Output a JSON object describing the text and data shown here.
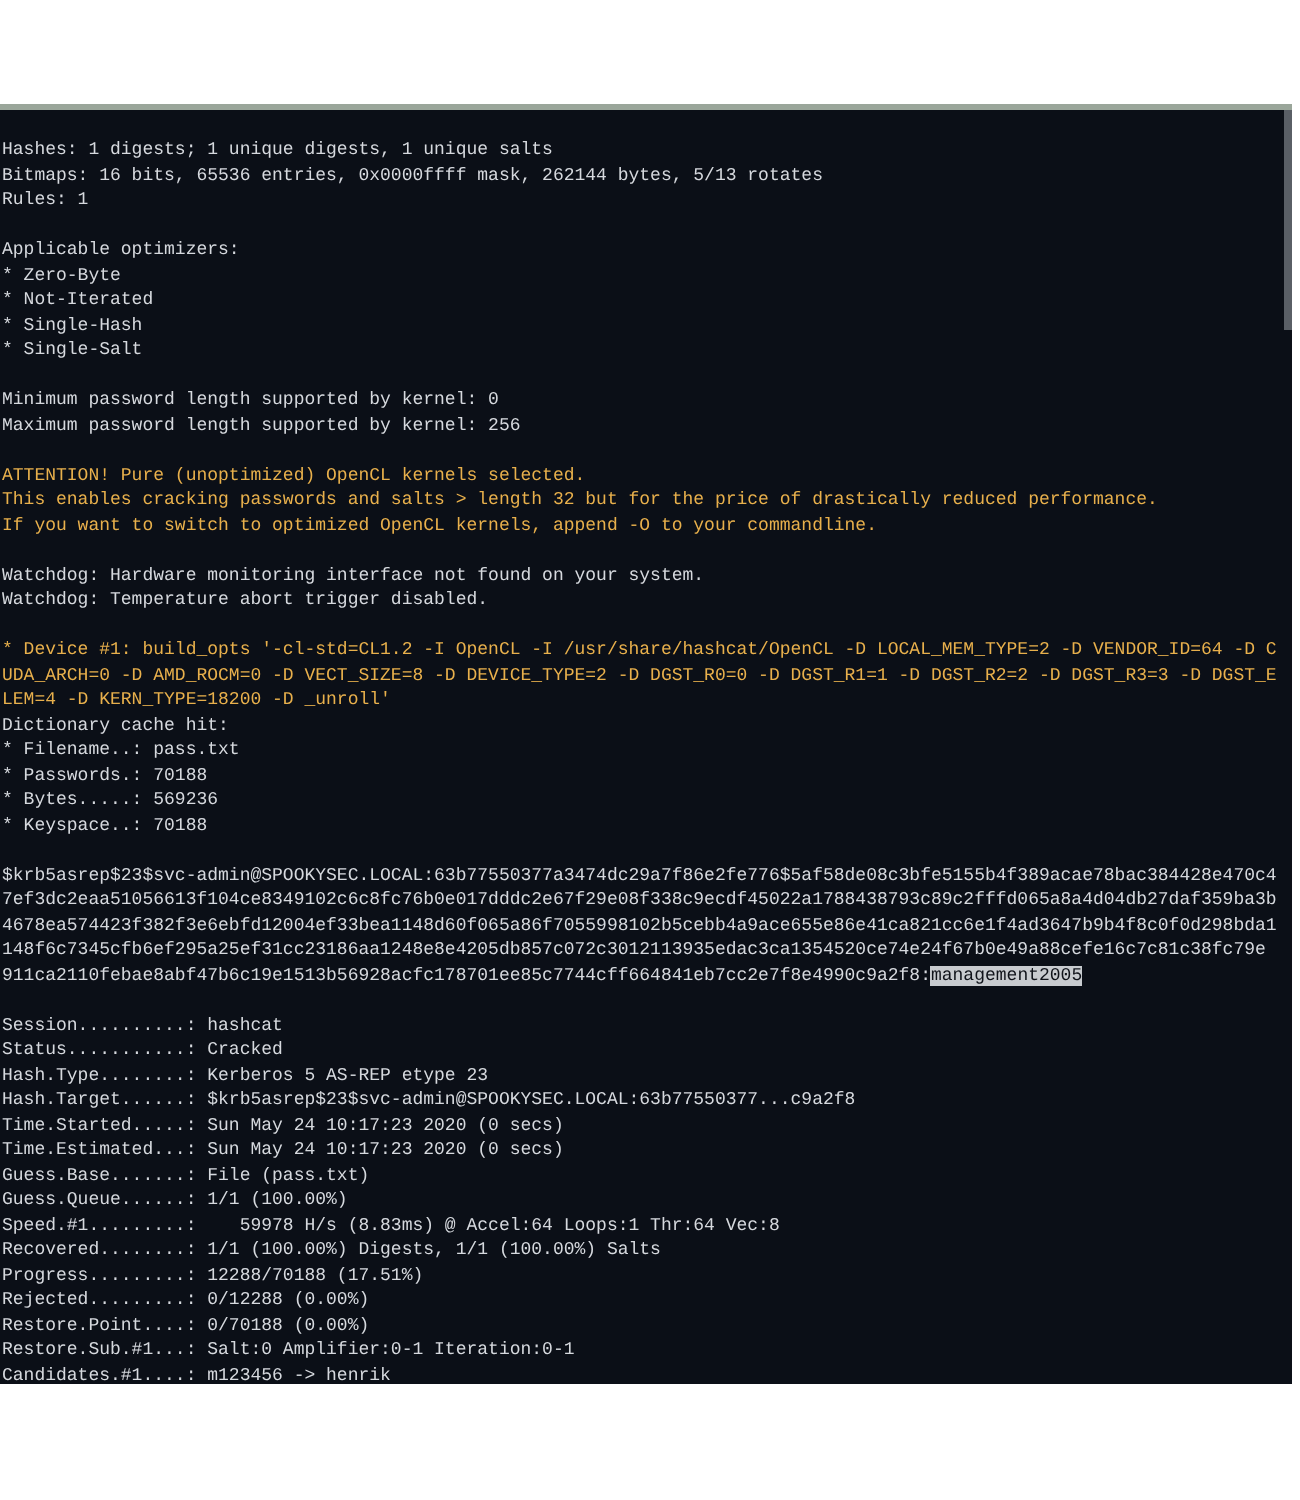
{
  "terminal": {
    "blocks": [
      {
        "lines": [
          {
            "kind": "plain",
            "text": "Hashes: 1 digests; 1 unique digests, 1 unique salts"
          },
          {
            "kind": "plain",
            "text": "Bitmaps: 16 bits, 65536 entries, 0x0000ffff mask, 262144 bytes, 5/13 rotates"
          },
          {
            "kind": "plain",
            "text": "Rules: 1"
          }
        ]
      },
      {
        "lines": [
          {
            "kind": "plain",
            "text": "Applicable optimizers:"
          },
          {
            "kind": "plain",
            "text": "* Zero-Byte"
          },
          {
            "kind": "plain",
            "text": "* Not-Iterated"
          },
          {
            "kind": "plain",
            "text": "* Single-Hash"
          },
          {
            "kind": "plain",
            "text": "* Single-Salt"
          }
        ]
      },
      {
        "lines": [
          {
            "kind": "plain",
            "text": "Minimum password length supported by kernel: 0"
          },
          {
            "kind": "plain",
            "text": "Maximum password length supported by kernel: 256"
          }
        ]
      },
      {
        "lines": [
          {
            "kind": "warning",
            "text": "ATTENTION! Pure (unoptimized) OpenCL kernels selected."
          },
          {
            "kind": "warning",
            "text": "This enables cracking passwords and salts > length 32 but for the price of drastically reduced performance."
          },
          {
            "kind": "warning",
            "text": "If you want to switch to optimized OpenCL kernels, append -O to your commandline."
          }
        ]
      },
      {
        "lines": [
          {
            "kind": "plain",
            "text": "Watchdog: Hardware monitoring interface not found on your system."
          },
          {
            "kind": "plain",
            "text": "Watchdog: Temperature abort trigger disabled."
          }
        ]
      },
      {
        "lines": [
          {
            "kind": "warning",
            "text": "* Device #1: build_opts '-cl-std=CL1.2 -I OpenCL -I /usr/share/hashcat/OpenCL -D LOCAL_MEM_TYPE=2 -D VENDOR_ID=64 -D C"
          },
          {
            "kind": "warning",
            "text": "UDA_ARCH=0 -D AMD_ROCM=0 -D VECT_SIZE=8 -D DEVICE_TYPE=2 -D DGST_R0=0 -D DGST_R1=1 -D DGST_R2=2 -D DGST_R3=3 -D DGST_E"
          },
          {
            "kind": "warning",
            "text": "LEM=4 -D KERN_TYPE=18200 -D _unroll'"
          },
          {
            "kind": "plain",
            "text": "Dictionary cache hit:"
          },
          {
            "kind": "plain",
            "text": "* Filename..: pass.txt"
          },
          {
            "kind": "plain",
            "text": "* Passwords.: 70188"
          },
          {
            "kind": "plain",
            "text": "* Bytes.....: 569236"
          },
          {
            "kind": "plain",
            "text": "* Keyspace..: 70188"
          }
        ]
      },
      {
        "lines": [
          {
            "kind": "plain",
            "text": "$krb5asrep$23$svc-admin@SPOOKYSEC.LOCAL:63b77550377a3474dc29a7f86e2fe776$5af58de08c3bfe5155b4f389acae78bac384428e470c4"
          },
          {
            "kind": "plain",
            "text": "7ef3dc2eaa51056613f104ce8349102c6c8fc76b0e017dddc2e67f29e08f338c9ecdf45022a1788438793c89c2fffd065a8a4d04db27daf359ba3b"
          },
          {
            "kind": "plain",
            "text": "4678ea574423f382f3e6ebfd12004ef33bea1148d60f065a86f7055998102b5cebb4a9ace655e86e41ca821cc6e1f4ad3647b9b4f8c0f0d298bda1"
          },
          {
            "kind": "plain",
            "text": "148f6c7345cfb6ef295a25ef31cc23186aa1248e8e4205db857c072c3012113935edac3ca1354520ce74e24f67b0e49a88cefe16c7c81c38fc79e"
          },
          {
            "kind": "plain",
            "text": "911ca2110febae8abf47b6c19e1513b56928acfc178701ee85c7744cff664841eb7cc2e7f8e4990c9a2f8:",
            "selection": "management2005"
          }
        ]
      },
      {
        "lines": [
          {
            "kind": "plain",
            "text": "Session..........: hashcat"
          },
          {
            "kind": "plain",
            "text": "Status...........: Cracked"
          },
          {
            "kind": "plain",
            "text": "Hash.Type........: Kerberos 5 AS-REP etype 23"
          },
          {
            "kind": "plain",
            "text": "Hash.Target......: $krb5asrep$23$svc-admin@SPOOKYSEC.LOCAL:63b77550377...c9a2f8"
          },
          {
            "kind": "plain",
            "text": "Time.Started.....: Sun May 24 10:17:23 2020 (0 secs)"
          },
          {
            "kind": "plain",
            "text": "Time.Estimated...: Sun May 24 10:17:23 2020 (0 secs)"
          },
          {
            "kind": "plain",
            "text": "Guess.Base.......: File (pass.txt)"
          },
          {
            "kind": "plain",
            "text": "Guess.Queue......: 1/1 (100.00%)"
          },
          {
            "kind": "plain",
            "text": "Speed.#1.........:    59978 H/s (8.83ms) @ Accel:64 Loops:1 Thr:64 Vec:8"
          },
          {
            "kind": "plain",
            "text": "Recovered........: 1/1 (100.00%) Digests, 1/1 (100.00%) Salts"
          },
          {
            "kind": "plain",
            "text": "Progress.........: 12288/70188 (17.51%)"
          },
          {
            "kind": "plain",
            "text": "Rejected.........: 0/12288 (0.00%)"
          },
          {
            "kind": "plain",
            "text": "Restore.Point....: 0/70188 (0.00%)"
          },
          {
            "kind": "plain",
            "text": "Restore.Sub.#1...: Salt:0 Amplifier:0-1 Iteration:0-1"
          },
          {
            "kind": "plain",
            "text": "Candidates.#1....: m123456 -> henrik"
          }
        ]
      }
    ]
  }
}
